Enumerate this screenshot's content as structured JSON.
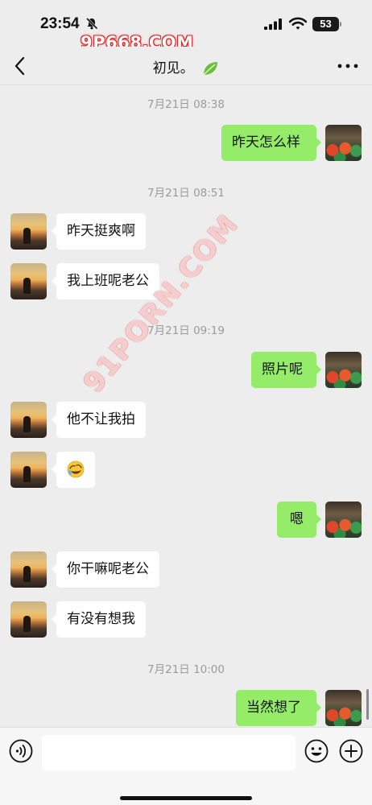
{
  "status_bar": {
    "time": "23:54",
    "battery": "53",
    "watermark": "9P668.COM"
  },
  "header": {
    "title": "初见。"
  },
  "watermark_diagonal": "91PORN.COM",
  "messages": [
    {
      "type": "time",
      "text": "7月21日 08:38"
    },
    {
      "type": "msg",
      "side": "right",
      "text": "昨天怎么样"
    },
    {
      "type": "time",
      "text": "7月21日 08:51"
    },
    {
      "type": "msg",
      "side": "left",
      "text": "昨天挺爽啊"
    },
    {
      "type": "msg",
      "side": "left",
      "text": "我上班呢老公"
    },
    {
      "type": "time",
      "text": "7月21日 09:19"
    },
    {
      "type": "msg",
      "side": "right",
      "text": "照片呢"
    },
    {
      "type": "msg",
      "side": "left",
      "text": "他不让我拍"
    },
    {
      "type": "msg",
      "side": "left",
      "text": "",
      "emoji": "rolling-laughing-emoji"
    },
    {
      "type": "msg",
      "side": "right",
      "text": "嗯"
    },
    {
      "type": "msg",
      "side": "left",
      "text": "你干嘛呢老公"
    },
    {
      "type": "msg",
      "side": "left",
      "text": "有没有想我"
    },
    {
      "type": "time",
      "text": "7月21日 10:00"
    },
    {
      "type": "msg",
      "side": "right",
      "text": "当然想了"
    }
  ],
  "input": {
    "value": "",
    "placeholder": ""
  },
  "icons": {
    "back": "chevron-left-icon",
    "more": "more-dots-icon",
    "voice": "voice-icon",
    "emoji": "smiley-icon",
    "plus": "plus-icon"
  },
  "colors": {
    "background": "#ededed",
    "bubble_self": "#95ec69",
    "bubble_other": "#ffffff",
    "timestamp": "#9b9b9b"
  }
}
